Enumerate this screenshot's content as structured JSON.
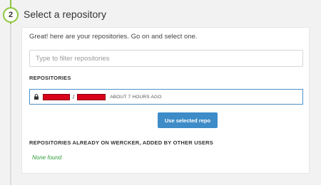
{
  "step": {
    "number": "2",
    "title": "Select a repository"
  },
  "intro_text": "Great! here are your repositories. Go on and select one.",
  "filter": {
    "placeholder": "Type to filter repositories",
    "value": ""
  },
  "repositories": {
    "heading": "REPOSITORIES",
    "items": [
      {
        "private": true,
        "owner": "[redacted]",
        "name": "[redacted]",
        "separator": "/",
        "updated": "ABOUT 7 HOURS AGO",
        "selected": true
      }
    ]
  },
  "use_button_label": "Use selected repo",
  "other_users": {
    "heading": "REPOSITORIES ALREADY ON WERCKER, ADDED BY OTHER USERS",
    "empty_text": "None found"
  },
  "colors": {
    "accent_green": "#8dc63f",
    "button_blue": "#3d8cc8",
    "selection_border": "#4a90c8",
    "redaction_red": "#d9001b",
    "empty_text_green": "#2e9e3e"
  }
}
